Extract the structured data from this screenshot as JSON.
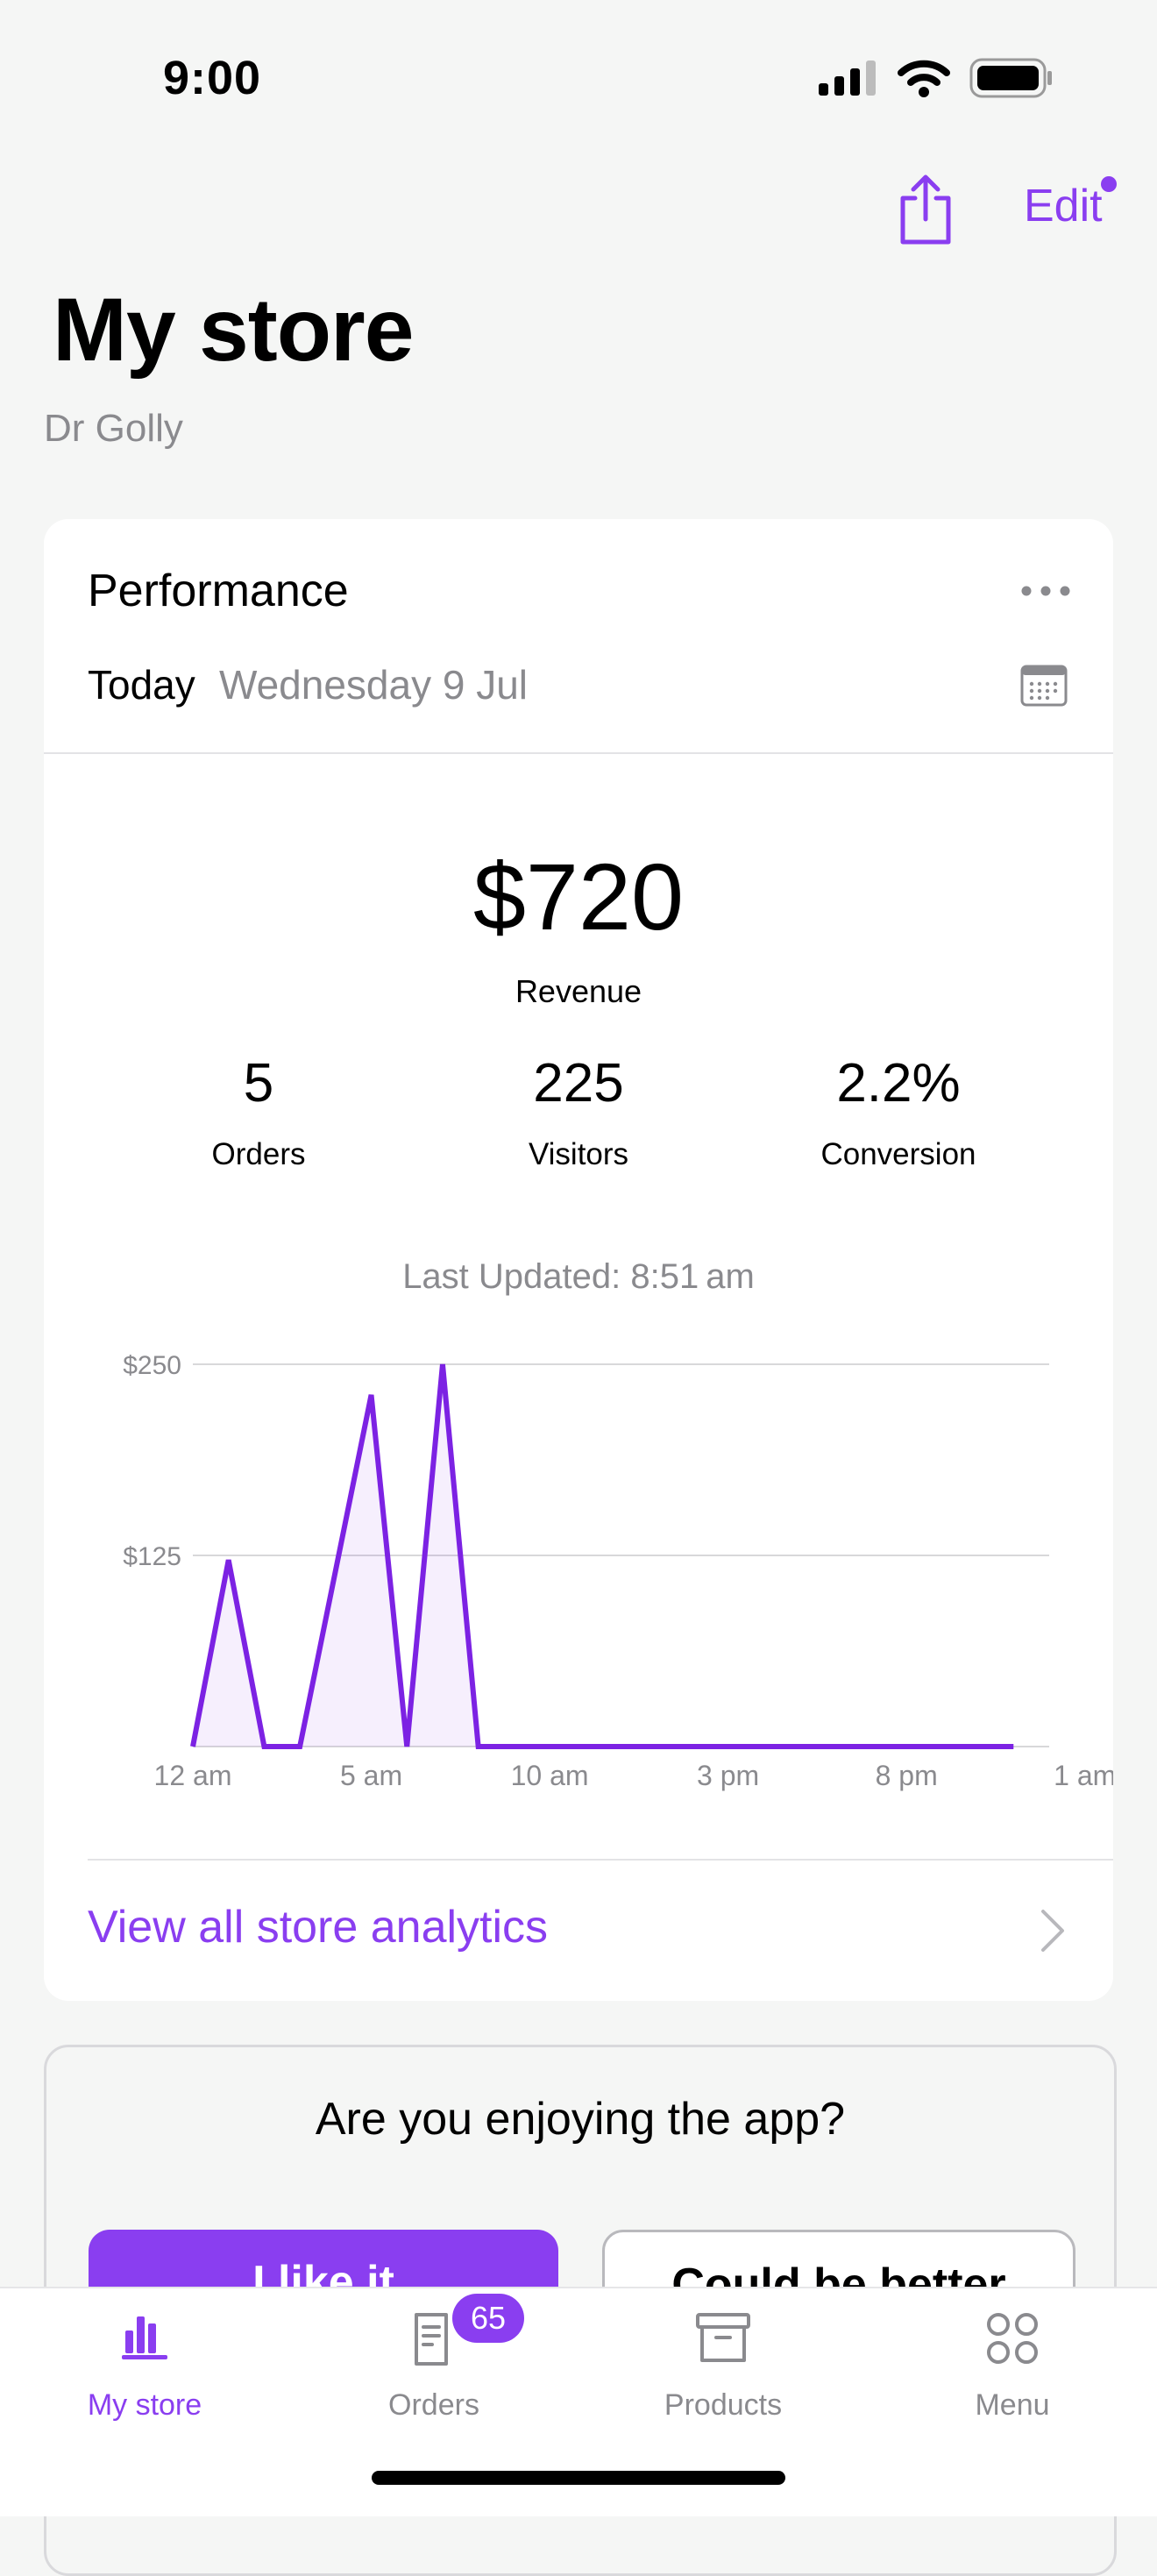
{
  "status_bar": {
    "time": "9:00"
  },
  "header": {
    "edit_label": "Edit",
    "title": "My store",
    "store_name": "Dr Golly"
  },
  "performance": {
    "title": "Performance",
    "date_range_label": "Today",
    "date": "Wednesday 9 Jul",
    "revenue": {
      "value": "$720",
      "label": "Revenue"
    },
    "stats": [
      {
        "value": "5",
        "label": "Orders"
      },
      {
        "value": "225",
        "label": "Visitors"
      },
      {
        "value": "2.2%",
        "label": "Conversion"
      }
    ],
    "last_updated": "Last Updated: 8:51 am",
    "analytics_link": "View all store analytics"
  },
  "chart_data": {
    "type": "area",
    "x_labels": [
      "12 am",
      "5 am",
      "10 am",
      "3 pm",
      "8 pm",
      "1 am"
    ],
    "y_labels": [
      "$250",
      "$125"
    ],
    "ylim": [
      0,
      250
    ],
    "x_hours": [
      0,
      1,
      2,
      3,
      4,
      5,
      6,
      7,
      8,
      9,
      10,
      11,
      12,
      13,
      14,
      15,
      16,
      17,
      18,
      19,
      20,
      21,
      22,
      23
    ],
    "values": [
      0,
      122,
      0,
      0,
      115,
      230,
      0,
      250,
      0,
      0,
      0,
      0,
      0,
      0,
      0,
      0,
      0,
      0,
      0,
      0,
      0,
      0,
      0,
      0
    ],
    "line_color": "#7c22e3",
    "grid": true
  },
  "feedback": {
    "question": "Are you enjoying the app?",
    "like_label": "I like it",
    "better_label": "Could be better"
  },
  "tabs": [
    {
      "label": "My store",
      "active": true
    },
    {
      "label": "Orders",
      "badge": "65"
    },
    {
      "label": "Products"
    },
    {
      "label": "Menu"
    }
  ],
  "colors": {
    "accent": "#8a3ef0",
    "background": "#f5f6f5"
  }
}
